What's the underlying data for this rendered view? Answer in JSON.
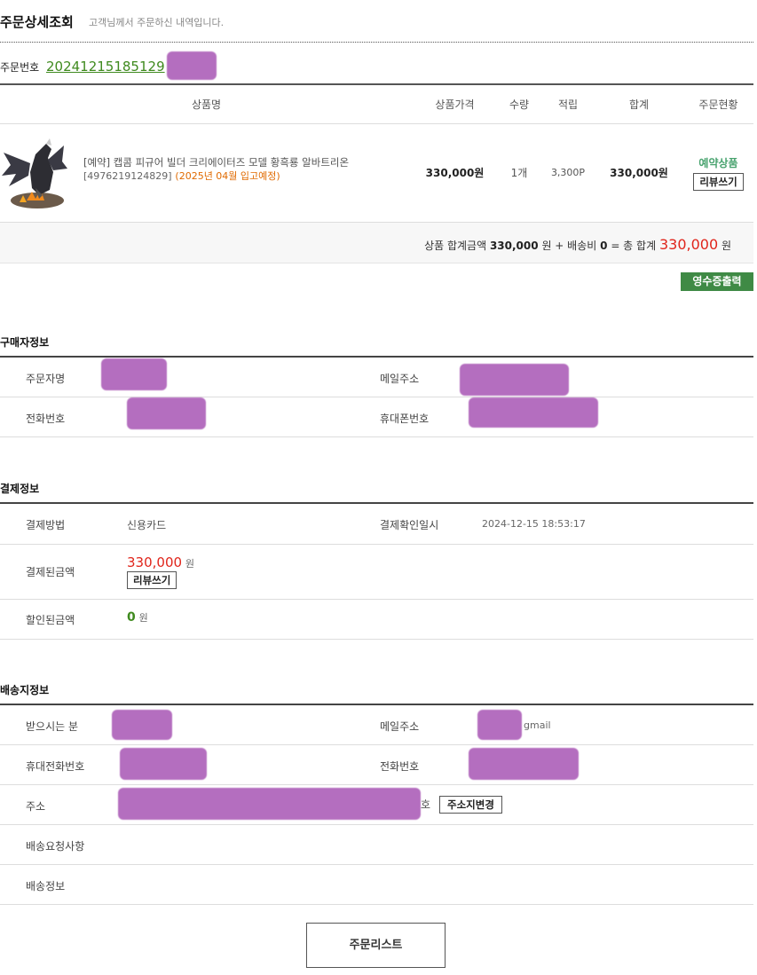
{
  "header": {
    "title": "주문상세조회",
    "desc": "고객님께서 주문하신 내역입니다."
  },
  "order": {
    "label": "주문번호",
    "number": "20241215185129"
  },
  "table": {
    "headers": [
      "상품명",
      "상품가격",
      "수량",
      "적립",
      "합계",
      "주문현황"
    ],
    "item": {
      "name": "[예약] 캡콤 피규어 빌더 크리에이터즈 모델 황흑룡 알바트리온",
      "code": "[4976219124829]",
      "eta": "(2025년 04월 입고예정)",
      "price": "330,000원",
      "qty": "1개",
      "points": "3,300P",
      "total": "330,000원",
      "status": "예약상품",
      "review_btn": "리뷰쓰기"
    }
  },
  "summary": {
    "label1": "상품 합계금액",
    "amount1": "330,000",
    "won1": "원 + 배송비",
    "shipping": "0",
    "label2": "= 총 합계",
    "total": "330,000",
    "won2": "원"
  },
  "receipt_btn": "영수증출력",
  "buyer": {
    "title": "구매자정보",
    "name_label": "주문자명",
    "email_label": "메일주소",
    "phone_label": "전화번호",
    "mobile_label": "휴대폰번호"
  },
  "payment": {
    "title": "결제정보",
    "method_label": "결제방법",
    "method": "신용카드",
    "confirm_label": "결제확인일시",
    "confirm_time": "2024-12-15 18:53:17",
    "paid_label": "결제된금액",
    "paid": "330,000",
    "won": "원",
    "review_btn": "리뷰쓰기",
    "discount_label": "할인된금액",
    "discount": "0",
    "won2": "원"
  },
  "shipping": {
    "title": "배송지정보",
    "receiver_label": "받으시는 분",
    "email_label": "메일주소",
    "email_suffix": "gmail",
    "mobile_label": "휴대전화번호",
    "phone_label": "전화번호",
    "address_label": "주소",
    "address_tail": "호",
    "change_btn": "주소지변경",
    "request_label": "배송요청사항",
    "info_label": "배송정보"
  },
  "list_btn": "주문리스트",
  "colors": {
    "green_link": "#3f8a1e",
    "red_total": "#e0251b",
    "receipt_bg": "#3f8a45",
    "redaction": "#a855b4"
  }
}
